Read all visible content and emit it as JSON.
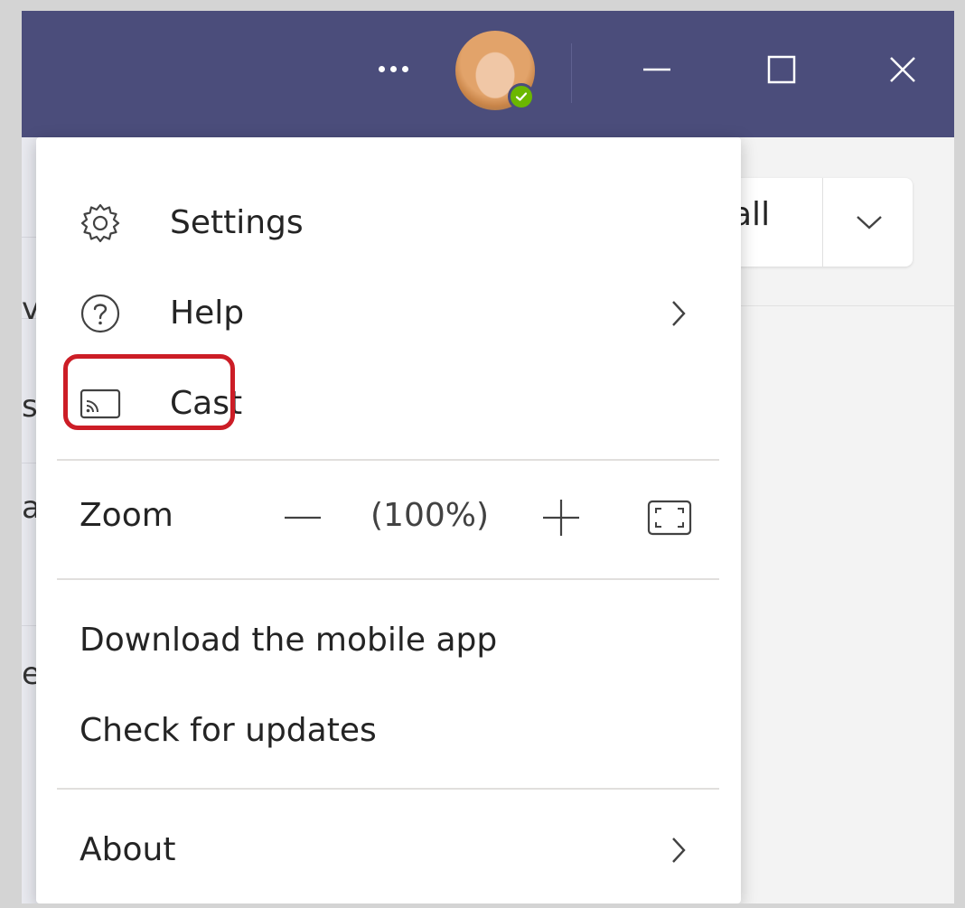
{
  "titlebar": {
    "more_icon": "more-horizontal-icon",
    "avatar_status": "available",
    "status_color": "#6bb700",
    "minimize_icon": "minimize-icon",
    "maximize_icon": "maximize-icon",
    "close_icon": "close-icon",
    "background_color": "#4b4d7b"
  },
  "background": {
    "call_button_label": "all",
    "strip_chars": [
      "v",
      "s",
      "a",
      "e"
    ]
  },
  "menu": {
    "items": [
      {
        "label": "Settings",
        "icon": "settings-gear-icon"
      },
      {
        "label": "Help",
        "icon": "help-circle-icon",
        "has_submenu": true
      },
      {
        "label": "Cast",
        "icon": "cast-icon",
        "highlighted": true
      }
    ],
    "zoom": {
      "label": "Zoom",
      "value": "(100%)",
      "minus_icon": "zoom-out-icon",
      "plus_icon": "zoom-in-icon",
      "fit_icon": "full-screen-icon"
    },
    "extra_items": [
      {
        "label": "Download the mobile app"
      },
      {
        "label": "Check for updates"
      }
    ],
    "about": {
      "label": "About",
      "has_submenu": true
    },
    "highlight_color": "#cc1d26"
  }
}
